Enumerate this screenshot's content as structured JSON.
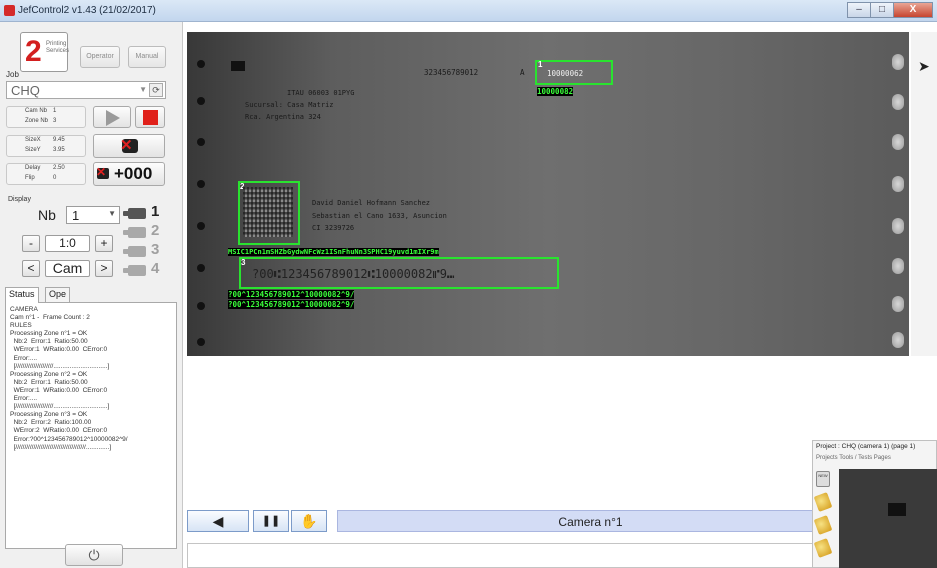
{
  "window": {
    "title": "JefControl2 v1.43 (21/02/2017)",
    "btn_min": "–",
    "btn_max": "□",
    "btn_close": "X"
  },
  "left": {
    "logo_text": "Printing\nServices",
    "operator_label": "Operator",
    "manual_label": "Manual",
    "job_label": "Job",
    "job_value": "CHQ",
    "cam_nb_label": "Cam Nb",
    "cam_nb_value": "1",
    "zone_nb_label": "Zone Nb",
    "zone_nb_value": "3",
    "size_x_label": "SizeX",
    "size_x_value": "9.45",
    "size_y_label": "SizeY",
    "size_y_value": "3.95",
    "delay_label": "Delay",
    "delay_value": "2.50",
    "flip_label": "Flip",
    "flip_value": "0",
    "counter_label": "+000",
    "display_label": "Display",
    "nb_label": "Nb",
    "nb_value": "1",
    "zoom_minus": "-",
    "zoom_value": "1:0",
    "zoom_plus": "+",
    "cam_prev": "<",
    "cam_label": "Cam",
    "cam_next": ">",
    "cam_buttons": [
      "1",
      "2",
      "3",
      "4"
    ],
    "tab_status": "Status",
    "tab_ope": "Ope",
    "log": [
      "CAMERA",
      "Cam n°1 -  Frame Count : 2",
      "",
      "RULES",
      "Processing Zone n°1 = OK",
      "  Nb:2  Error:1  Ratio:50.00",
      "  WError:1  WRatio:0.00  CError:0",
      "  Error:....",
      "  [/////////////////////..............................]",
      "Processing Zone n°2 = OK",
      "  Nb:2  Error:1  Ratio:50.00",
      "  WError:1  WRatio:0.00  CError:0",
      "  Error:....",
      "  [/////////////////////..............................]",
      "Processing Zone n°3 = OK",
      "  Nb:2  Error:2  Ratio:100.00",
      "  WError:2  WRatio:0.00  CError:0",
      "  Error:?00^123456789012^10000082^9/",
      "  [///////////////////////////////////////.............]"
    ],
    "power_icon": "⏻"
  },
  "camera": {
    "top_number": "323456789012",
    "top_letter": "A",
    "zone1_text": "10000062",
    "zone1_read": "10000082",
    "bank_line": "ITAU 06003 01PYG",
    "branch_line": "Sucursal: Casa Matriz",
    "address_line": "Rca. Argentina 324",
    "name_line": "David Daniel Hofmann Sanchez",
    "street_line": "Sebastian el Cano 1633, Asuncion",
    "ci_line": "CI 3239726",
    "datamatrix_read": "MSIC1PCn1mSHZbGydwNFcWz1ISnFhuNn3SPHC19yuvd1mIXr9m",
    "micr_line": "?00⑆123456789012⑆10000082⑈9⑉",
    "micr_read_1": "?00^123456789012^10000082^9/",
    "micr_read_2": "?00^123456789012^10000082^9/",
    "zone_labels": [
      "1",
      "2",
      "3"
    ]
  },
  "toolbar": {
    "back_icon": "◀",
    "pause_icon": "❚❚",
    "hand_icon": "✋",
    "camera_title": "Camera n°1"
  },
  "project": {
    "title": "Project : CHQ (camera 1) (page 1)",
    "menu": "Projects    Tools / Tests    Pages",
    "new_label": "NEW"
  }
}
